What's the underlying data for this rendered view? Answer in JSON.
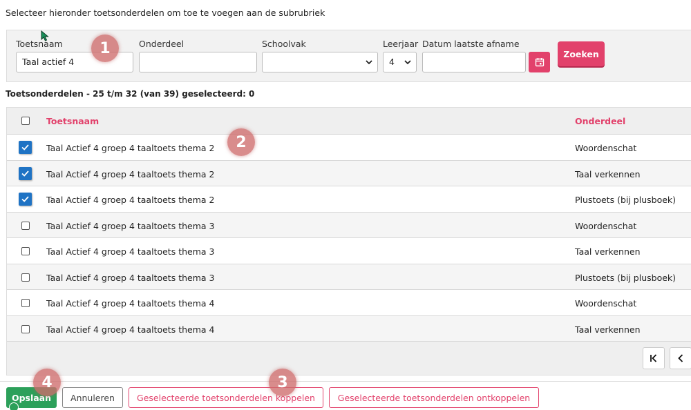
{
  "intro": "Selecteer hieronder toetsonderdelen om toe te voegen aan de subrubriek",
  "filters": {
    "toetsnaam_label": "Toetsnaam",
    "toetsnaam_value": "Taal actief 4",
    "onderdeel_label": "Onderdeel",
    "onderdeel_value": "",
    "schoolvak_label": "Schoolvak",
    "schoolvak_value": "",
    "leerjaar_label": "Leerjaar",
    "leerjaar_value": "4",
    "datum_label": "Datum laatste afname",
    "datum_value": "",
    "search_label": "Zoeken"
  },
  "subtitle": "Toetsonderdelen - 25 t/m 32 (van 39) geselecteerd: 0",
  "table": {
    "columns": [
      "Toetsnaam",
      "Onderdeel"
    ],
    "rows": [
      {
        "name": "Taal Actief 4 groep 4 taaltoets thema 2",
        "part": "Woordenschat",
        "checked": true
      },
      {
        "name": "Taal Actief 4 groep 4 taaltoets thema 2",
        "part": "Taal verkennen",
        "checked": true
      },
      {
        "name": "Taal Actief 4 groep 4 taaltoets thema 2",
        "part": "Plustoets (bij plusboek)",
        "checked": true
      },
      {
        "name": "Taal Actief 4 groep 4 taaltoets thema 3",
        "part": "Woordenschat",
        "checked": false
      },
      {
        "name": "Taal Actief 4 groep 4 taaltoets thema 3",
        "part": "Taal verkennen",
        "checked": false
      },
      {
        "name": "Taal Actief 4 groep 4 taaltoets thema 3",
        "part": "Plustoets (bij plusboek)",
        "checked": false
      },
      {
        "name": "Taal Actief 4 groep 4 taaltoets thema 4",
        "part": "Woordenschat",
        "checked": false
      },
      {
        "name": "Taal Actief 4 groep 4 taaltoets thema 4",
        "part": "Taal verkennen",
        "checked": false
      }
    ]
  },
  "pager": {
    "first_icon": "first-page-icon",
    "prev_icon": "previous-page-icon"
  },
  "footer": {
    "save": "Opslaan",
    "cancel": "Annuleren",
    "link": "Geselecteerde toetsonderdelen koppelen",
    "unlink": "Geselecteerde toetsonderdelen ontkoppelen"
  },
  "markers": [
    "1",
    "2",
    "3",
    "4"
  ],
  "colors": {
    "accent": "#e2416b",
    "checkbox": "#1f73c4",
    "save": "#2ca05a",
    "marker": "#ce6c6c"
  }
}
